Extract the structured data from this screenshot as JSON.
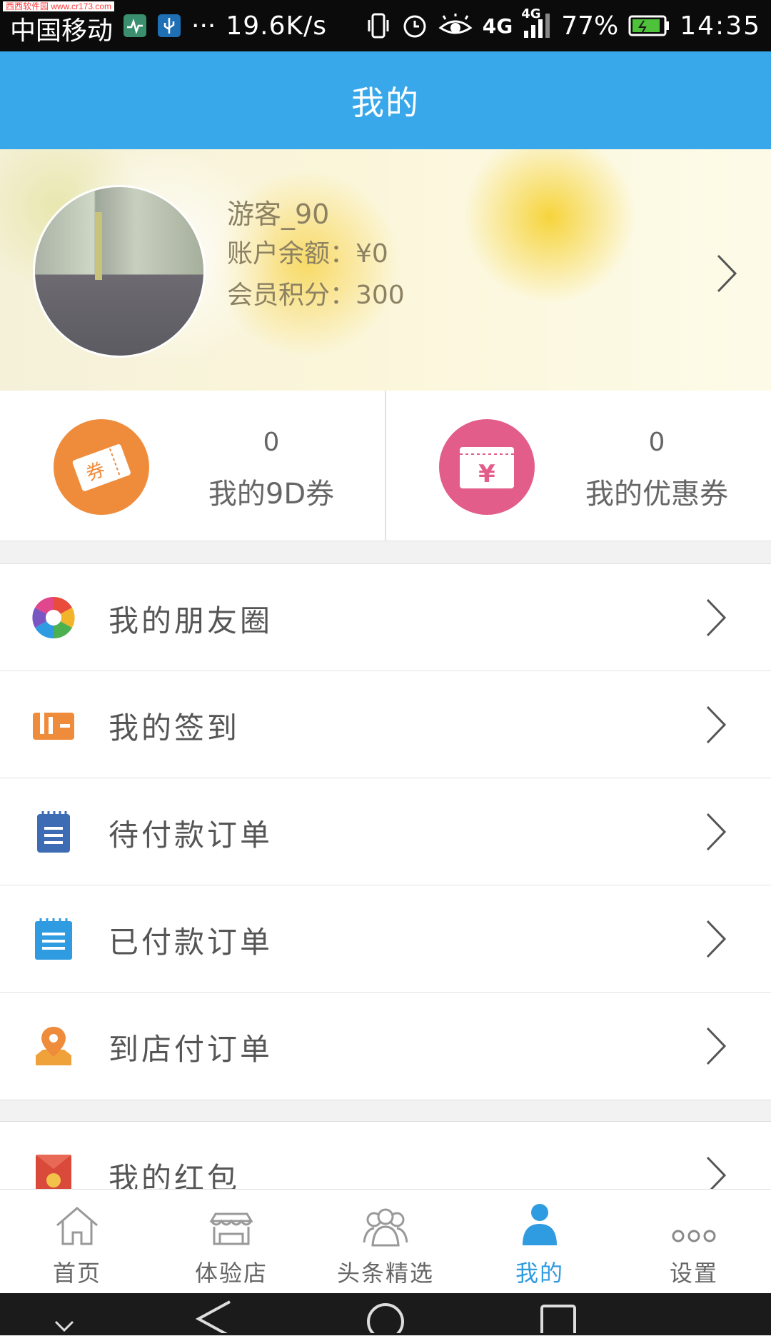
{
  "watermark": "西西软件园 www.cr173.com",
  "status_bar": {
    "carrier": "中国移动",
    "dots": "···",
    "speed": "19.6K/s",
    "network_4g": "4G",
    "network_4g_small": "4G",
    "battery_percent": "77%",
    "time": "14:35",
    "icons": [
      "health-app-icon",
      "usb-icon",
      "vibrate-icon",
      "alarm-icon",
      "eye-icon",
      "signal-icon",
      "battery-icon"
    ]
  },
  "header": {
    "title": "我的"
  },
  "profile": {
    "username": "游客_90",
    "balance_line": "账户余额：¥0",
    "points_line": "会员积分：300"
  },
  "vouchers": [
    {
      "count": "0",
      "label": "我的9D券",
      "icon_text": "券",
      "color": "#ef8c3c"
    },
    {
      "count": "0",
      "label": "我的优惠券",
      "icon_text": "¥",
      "color": "#e35d8a"
    }
  ],
  "menu": [
    {
      "label": "我的朋友圈",
      "icon": "aperture-icon"
    },
    {
      "label": "我的签到",
      "icon": "checkin-icon"
    },
    {
      "label": "待付款订单",
      "icon": "notepad-icon"
    },
    {
      "label": "已付款订单",
      "icon": "notepad-blue-icon"
    },
    {
      "label": "到店付订单",
      "icon": "location-pin-icon"
    }
  ],
  "menu2": [
    {
      "label": "我的红包",
      "icon": "red-envelope-icon"
    }
  ],
  "tabs": [
    {
      "label": "首页",
      "icon": "home-icon",
      "active": false
    },
    {
      "label": "体验店",
      "icon": "store-icon",
      "active": false
    },
    {
      "label": "头条精选",
      "icon": "group-icon",
      "active": false
    },
    {
      "label": "我的",
      "icon": "person-icon",
      "active": true
    },
    {
      "label": "设置",
      "icon": "more-dots-icon",
      "active": false
    }
  ],
  "colors": {
    "header_blue": "#39a8ea",
    "active_tab": "#2f9be0",
    "voucher_orange": "#ef8c3c",
    "voucher_pink": "#e35d8a"
  }
}
